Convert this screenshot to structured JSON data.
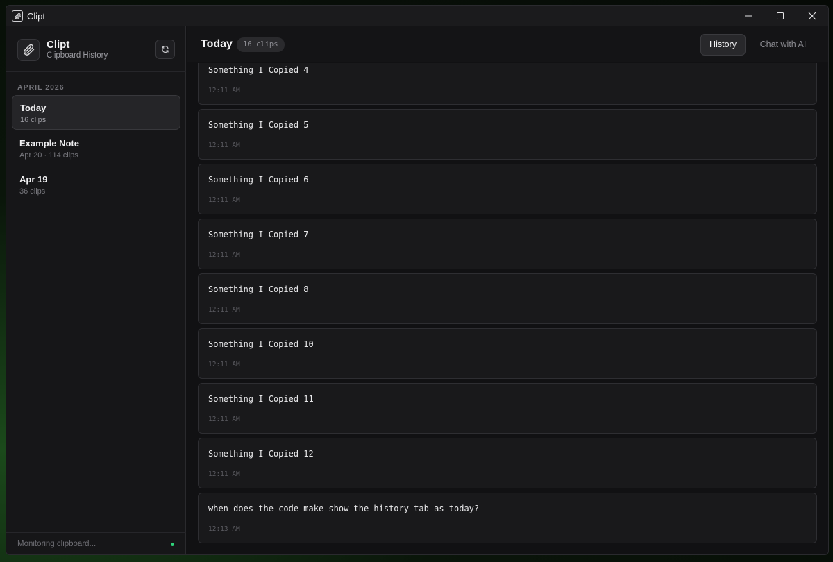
{
  "window": {
    "title": "Clipt"
  },
  "sidebar": {
    "app_name": "Clipt",
    "app_subtitle": "Clipboard History",
    "section_label": "APRIL 2026",
    "days": [
      {
        "title": "Today",
        "sub": "16 clips",
        "active": true
      },
      {
        "title": "Example Note",
        "sub": "Apr 20  ·  114 clips",
        "active": false
      },
      {
        "title": "Apr 19",
        "sub": "36 clips",
        "active": false
      }
    ],
    "footer_status": "Monitoring clipboard...",
    "status_color": "#2fd27a"
  },
  "main": {
    "title": "Today",
    "count": "16 clips",
    "tabs": [
      {
        "label": "History",
        "active": true
      },
      {
        "label": "Chat with AI",
        "active": false
      }
    ],
    "clips": [
      {
        "text": "Something I Copied 4",
        "time": "12:11 AM"
      },
      {
        "text": "Something I Copied 5",
        "time": "12:11 AM"
      },
      {
        "text": "Something I Copied 6",
        "time": "12:11 AM"
      },
      {
        "text": "Something I Copied 7",
        "time": "12:11 AM"
      },
      {
        "text": "Something I Copied 8",
        "time": "12:11 AM"
      },
      {
        "text": "Something I Copied 10",
        "time": "12:11 AM"
      },
      {
        "text": "Something I Copied 11",
        "time": "12:11 AM"
      },
      {
        "text": "Something I Copied 12",
        "time": "12:11 AM"
      },
      {
        "text": "when does the code make show the history tab as today?",
        "time": "12:13 AM"
      }
    ]
  }
}
